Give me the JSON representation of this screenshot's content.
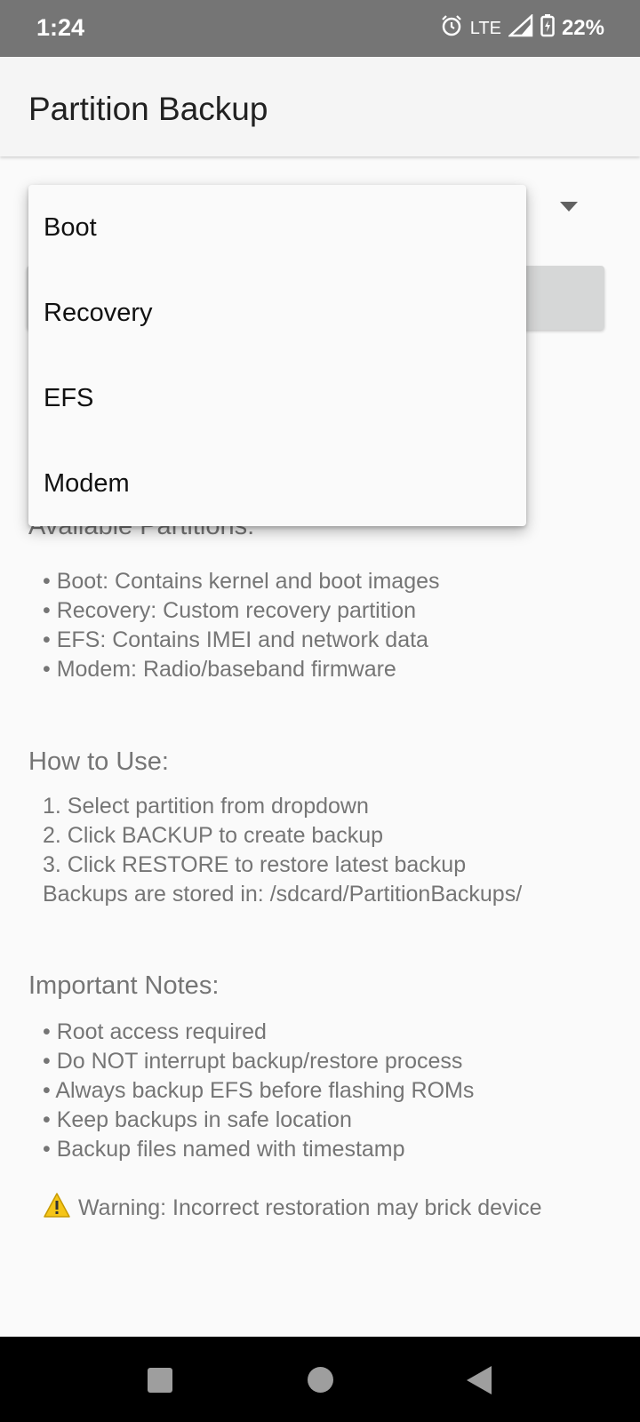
{
  "status_bar": {
    "time": "1:24",
    "network": "LTE",
    "battery": "22%",
    "icons": [
      "alarm-icon",
      "signal-icon",
      "battery-charging-icon"
    ]
  },
  "app_bar": {
    "title": "Partition Backup"
  },
  "dropdown": {
    "options": [
      "Boot",
      "Recovery",
      "EFS",
      "Modem"
    ]
  },
  "sections": {
    "partitions": {
      "title": "Available Partitions:",
      "items": [
        "• Boot: Contains kernel and boot images",
        "• Recovery: Custom recovery partition",
        "• EFS: Contains IMEI and network data",
        "• Modem: Radio/baseband firmware"
      ]
    },
    "howto": {
      "title": "How to Use:",
      "items": [
        "1. Select partition from dropdown",
        "2. Click BACKUP to create backup",
        "3. Click RESTORE to restore latest backup",
        "Backups are stored in: /sdcard/PartitionBackups/"
      ]
    },
    "notes": {
      "title": "Important Notes:",
      "items": [
        "• Root access required",
        "• Do NOT interrupt backup/restore process",
        "• Always backup EFS before flashing ROMs",
        "• Keep backups in safe location",
        "• Backup files named with timestamp"
      ]
    },
    "warning": {
      "icon": "warning-icon",
      "text": "Warning: Incorrect restoration may brick device"
    }
  },
  "nav_bar": {
    "icons": [
      "recents-icon",
      "home-icon",
      "back-icon"
    ]
  }
}
